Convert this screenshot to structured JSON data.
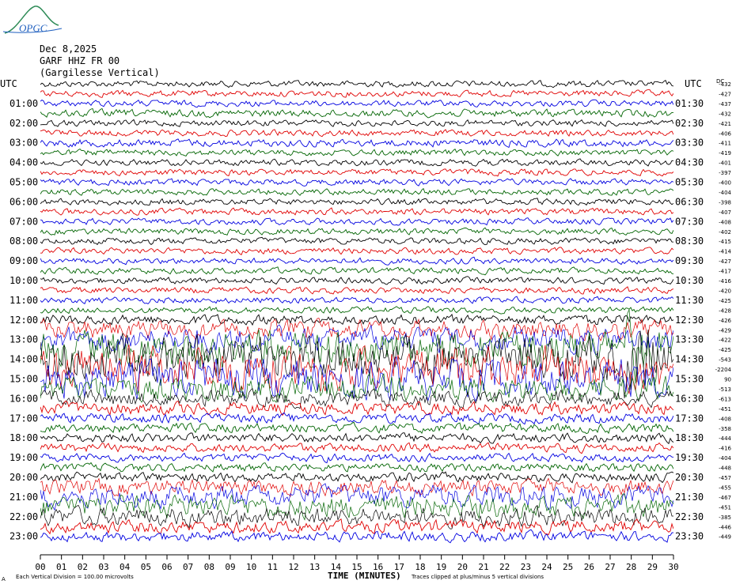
{
  "header": {
    "logo_text": "OPGC",
    "date": "Dec 8,2025",
    "station": "GARF HHZ FR 00",
    "site": "(Gargilesse Vertical)"
  },
  "labels": {
    "left_unit": "UTC",
    "right_unit": "UTC",
    "right_offset_head": "DC",
    "x_axis_title": "TIME (MINUTES)",
    "scale_note": "Each Vertical Division =  100.00 microvolts",
    "clip_note": "Traces clipped at plus/minus 5 vertical divisions",
    "corner_mark": "A"
  },
  "colors": {
    "trace_cycle": [
      "#000000",
      "#e00000",
      "#0000e0",
      "#006400"
    ],
    "background": "#ffffff"
  },
  "chart_data": {
    "type": "line",
    "description_of_axes": "helicorder",
    "xlabel": "TIME (MINUTES)",
    "xlim": [
      0,
      30
    ],
    "x_ticks": [
      "00",
      "01",
      "02",
      "03",
      "04",
      "05",
      "06",
      "07",
      "08",
      "09",
      "10",
      "11",
      "12",
      "13",
      "14",
      "15",
      "16",
      "17",
      "18",
      "19",
      "20",
      "21",
      "22",
      "23",
      "24",
      "25",
      "26",
      "27",
      "28",
      "29",
      "30"
    ],
    "lines_per_hour": 2,
    "minutes_per_line": 30,
    "left_hour_labels": [
      "01:00",
      "02:00",
      "03:00",
      "04:00",
      "05:00",
      "06:00",
      "07:00",
      "08:00",
      "09:00",
      "10:00",
      "11:00",
      "12:00",
      "13:00",
      "14:00",
      "15:00",
      "16:00",
      "17:00",
      "18:00",
      "19:00",
      "20:00",
      "21:00",
      "22:00",
      "23:00"
    ],
    "right_hour_labels": [
      "01:30",
      "02:30",
      "03:30",
      "04:30",
      "05:30",
      "06:30",
      "07:30",
      "08:30",
      "09:30",
      "10:30",
      "11:30",
      "12:30",
      "13:30",
      "14:30",
      "15:30",
      "16:30",
      "17:30",
      "18:30",
      "19:30",
      "20:30",
      "21:30",
      "22:30",
      "23:30"
    ],
    "dc_offsets": [
      "-432",
      "-427",
      "-437",
      "-432",
      "-421",
      "-406",
      "-411",
      "-419",
      "-401",
      "-397",
      "-400",
      "-404",
      "-398",
      "-407",
      "-408",
      "-402",
      "-415",
      "-414",
      "-427",
      "-417",
      "-416",
      "-420",
      "-425",
      "-428",
      "-426",
      "-429",
      "-422",
      "-425",
      "-543",
      "-2204",
      "90",
      "-513",
      "-613",
      "-451",
      "-408",
      "-358",
      "-444",
      "-416",
      "-404",
      "-448",
      "-457",
      "-455",
      "-467",
      "-451",
      "-385",
      "-446",
      "-449"
    ],
    "trace_activity": [
      1,
      1,
      1,
      1.2,
      1,
      1,
      1.2,
      1,
      1,
      1,
      1,
      1,
      1,
      1,
      1,
      1,
      1,
      1,
      1,
      1,
      1,
      1,
      1,
      1,
      1.6,
      3,
      4,
      6,
      7,
      7,
      6,
      4,
      2.5,
      2,
      1.5,
      1.5,
      1.5,
      1.4,
      1.3,
      1.3,
      1.5,
      2.5,
      3.5,
      3.5,
      3,
      2,
      1.6
    ],
    "scale_microvolts_per_division": 100.0,
    "clip_divisions": 5
  }
}
